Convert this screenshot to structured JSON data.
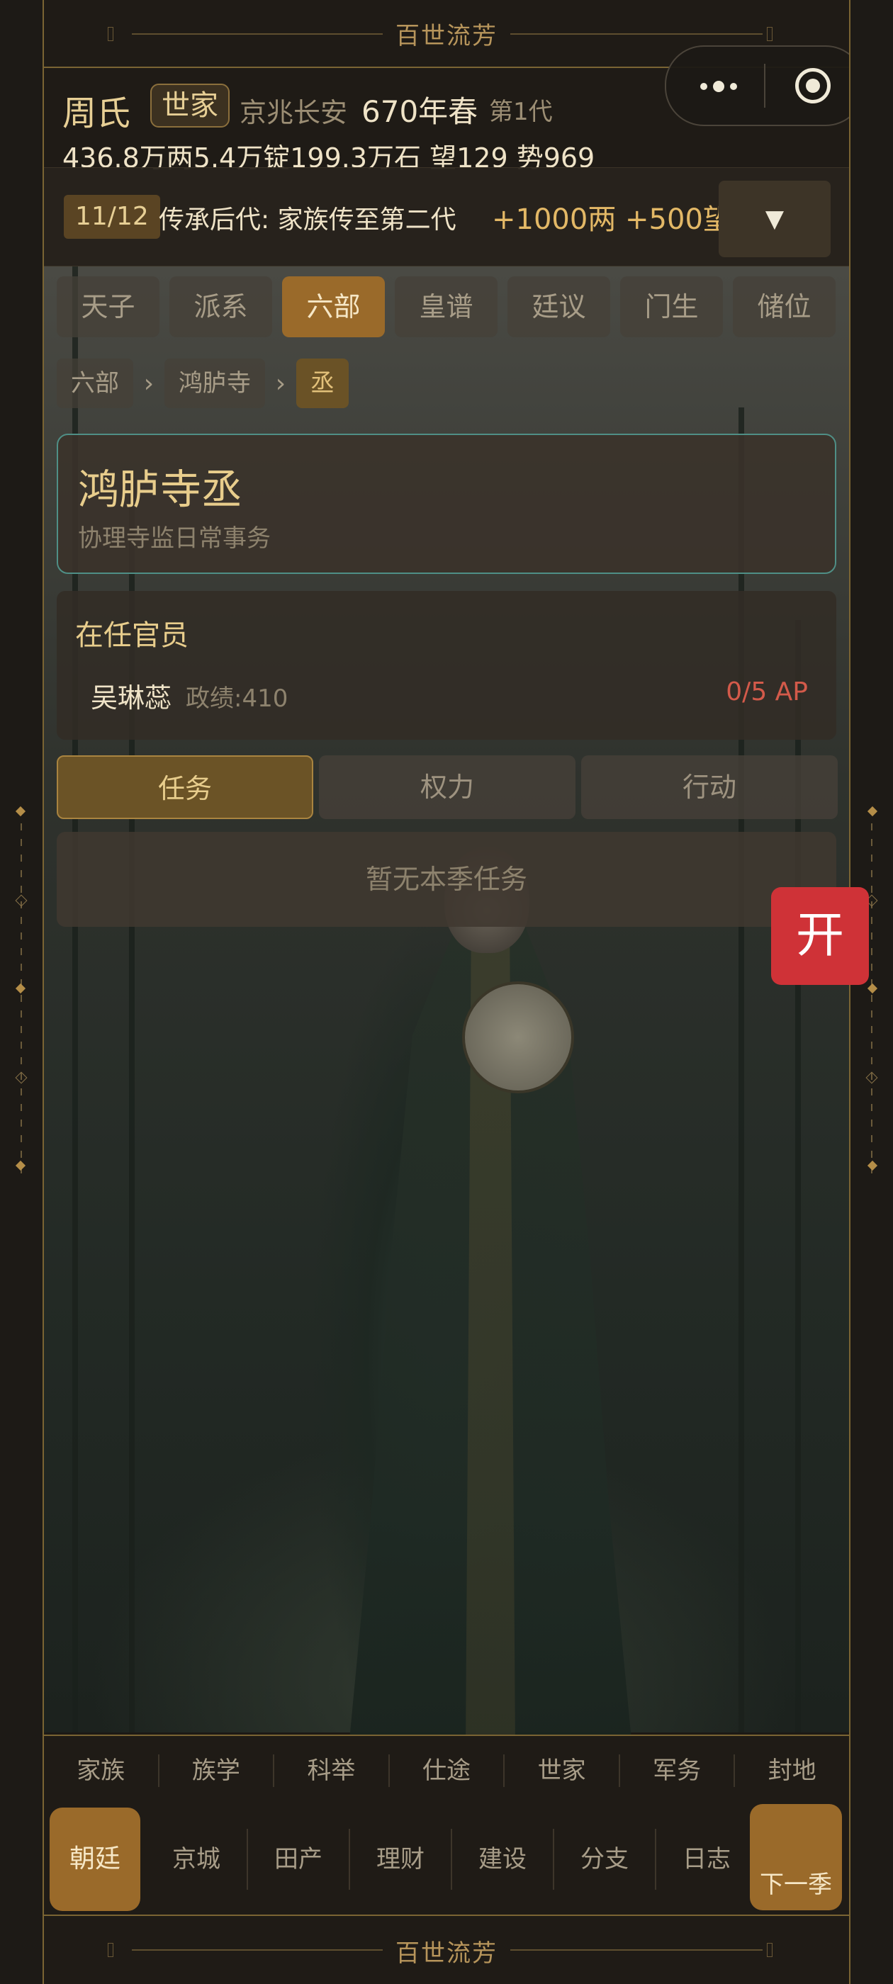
{
  "banner": {
    "title": "百世流芳"
  },
  "header": {
    "clan": "周氏",
    "clan_badge": "世家",
    "location": "京兆长安",
    "year": "670年春",
    "generation": "第1代",
    "stats": "436.8万两5.4万锭199.3万石  望129 势969"
  },
  "quest": {
    "count": "11/12",
    "text": "传承后代: 家族传至第二代",
    "reward": "+1000两 +500望",
    "toggle": "▼"
  },
  "tabs": [
    "天子",
    "派系",
    "六部",
    "皇谱",
    "廷议",
    "门生",
    "储位"
  ],
  "breadcrumb": {
    "items": [
      "六部",
      "鸿胪寺",
      "丞"
    ],
    "sep": "›"
  },
  "office": {
    "title": "鸿胪寺丞",
    "desc": "协理寺监日常事务"
  },
  "holders": {
    "title": "在任官员",
    "name": "吴琳蕊",
    "merit": "政绩:410",
    "ap": "0/5 AP"
  },
  "subtabs": [
    "任务",
    "权力",
    "行动"
  ],
  "tasks_empty": "暂无本季任务",
  "open_button": "开",
  "nav1": [
    "家族",
    "族学",
    "科举",
    "仕途",
    "世家",
    "军务",
    "封地"
  ],
  "nav2": {
    "main": "朝廷",
    "items": [
      "京城",
      "田产",
      "理财",
      "建设",
      "分支",
      "日志"
    ],
    "next": "下一季"
  }
}
